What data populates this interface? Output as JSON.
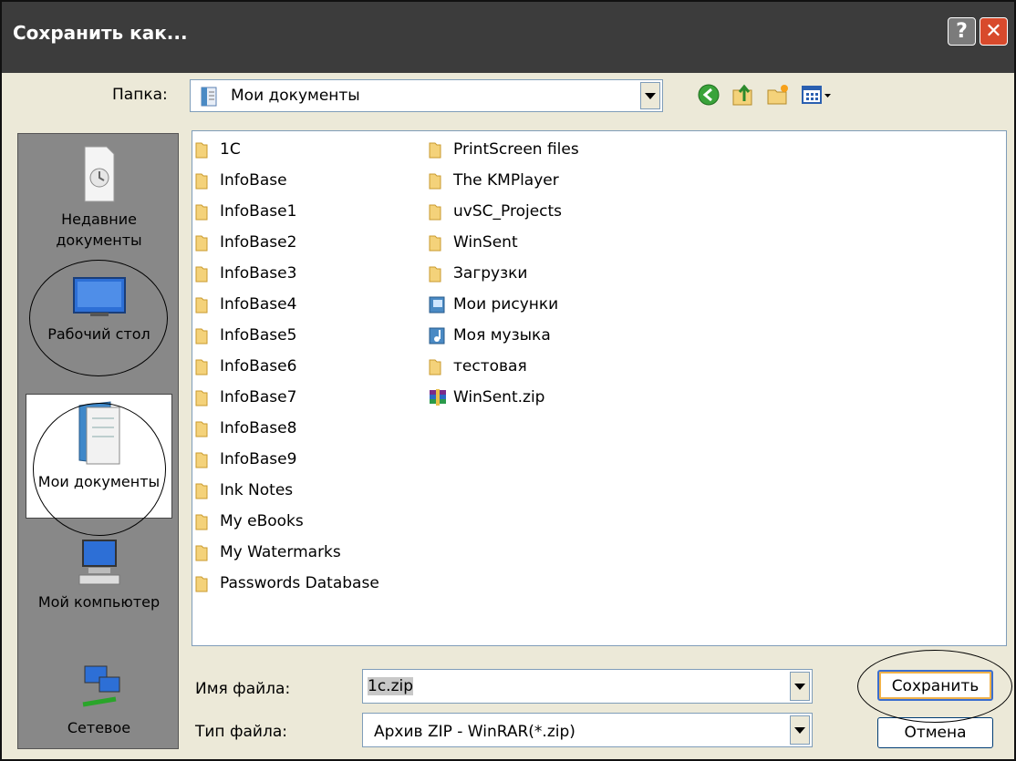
{
  "window": {
    "title": "Сохранить как...",
    "help_label": "?",
    "close_label": "✕"
  },
  "lookin": {
    "label": "Папка:",
    "value": "Мои документы"
  },
  "toolbar": {
    "icons": [
      "back-icon",
      "up-folder-icon",
      "new-folder-icon",
      "view-menu-icon"
    ]
  },
  "places": [
    {
      "label": "Недавние документы",
      "icon": "recent-documents-icon"
    },
    {
      "label": "Рабочий стол",
      "icon": "desktop-icon"
    },
    {
      "label": "Мои документы",
      "icon": "my-documents-icon"
    },
    {
      "label": "Мой компьютер",
      "icon": "my-computer-icon"
    },
    {
      "label": "Сетевое",
      "icon": "network-icon"
    }
  ],
  "files": {
    "col1": [
      "1C",
      "InfoBase",
      "InfoBase1",
      "InfoBase2",
      "InfoBase3",
      "InfoBase4",
      "InfoBase5",
      "InfoBase6",
      "InfoBase7",
      "InfoBase8",
      "InfoBase9",
      "Ink Notes",
      "My eBooks",
      "My Watermarks",
      "Passwords Database"
    ],
    "col2": [
      "PrintScreen files",
      "The KMPlayer",
      "uvSC_Projects",
      "WinSent",
      "Загрузки",
      "Мои рисунки",
      "Моя музыка",
      "тестовая",
      "WinSent.zip"
    ]
  },
  "filename": {
    "label": "Имя файла:",
    "value": "1c.zip"
  },
  "filetype": {
    "label": "Тип файла:",
    "value": "Архив ZIP - WinRAR(*.zip)"
  },
  "buttons": {
    "save": "Сохранить",
    "cancel": "Отмена"
  },
  "colors": {
    "titlebar": "#3c3c3c",
    "dialog_bg": "#ECE9D8",
    "folder": "#f4d27a",
    "close": "#d84a2c"
  }
}
